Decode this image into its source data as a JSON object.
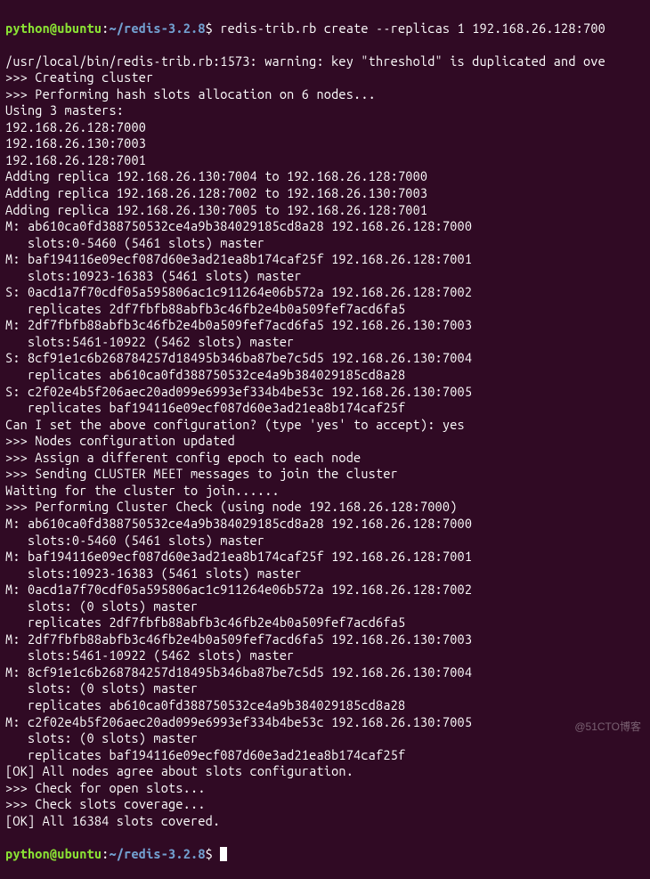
{
  "prompt": {
    "user": "python",
    "host": "ubuntu",
    "path": "~/redis-3.2.8",
    "symbol": "$"
  },
  "command": "redis-trib.rb create --replicas 1 192.168.26.128:700",
  "lines": [
    "/usr/local/bin/redis-trib.rb:1573: warning: key \"threshold\" is duplicated and ove",
    ">>> Creating cluster",
    ">>> Performing hash slots allocation on 6 nodes...",
    "Using 3 masters:",
    "192.168.26.128:7000",
    "192.168.26.130:7003",
    "192.168.26.128:7001",
    "Adding replica 192.168.26.130:7004 to 192.168.26.128:7000",
    "Adding replica 192.168.26.128:7002 to 192.168.26.130:7003",
    "Adding replica 192.168.26.130:7005 to 192.168.26.128:7001",
    "M: ab610ca0fd388750532ce4a9b384029185cd8a28 192.168.26.128:7000",
    "   slots:0-5460 (5461 slots) master",
    "M: baf194116e09ecf087d60e3ad21ea8b174caf25f 192.168.26.128:7001",
    "   slots:10923-16383 (5461 slots) master",
    "S: 0acd1a7f70cdf05a595806ac1c911264e06b572a 192.168.26.128:7002",
    "   replicates 2df7fbfb88abfb3c46fb2e4b0a509fef7acd6fa5",
    "M: 2df7fbfb88abfb3c46fb2e4b0a509fef7acd6fa5 192.168.26.130:7003",
    "   slots:5461-10922 (5462 slots) master",
    "S: 8cf91e1c6b268784257d18495b346ba87be7c5d5 192.168.26.130:7004",
    "   replicates ab610ca0fd388750532ce4a9b384029185cd8a28",
    "S: c2f02e4b5f206aec20ad099e6993ef334b4be53c 192.168.26.130:7005",
    "   replicates baf194116e09ecf087d60e3ad21ea8b174caf25f",
    "Can I set the above configuration? (type 'yes' to accept): yes",
    ">>> Nodes configuration updated",
    ">>> Assign a different config epoch to each node",
    ">>> Sending CLUSTER MEET messages to join the cluster",
    "Waiting for the cluster to join......",
    ">>> Performing Cluster Check (using node 192.168.26.128:7000)",
    "M: ab610ca0fd388750532ce4a9b384029185cd8a28 192.168.26.128:7000",
    "   slots:0-5460 (5461 slots) master",
    "M: baf194116e09ecf087d60e3ad21ea8b174caf25f 192.168.26.128:7001",
    "   slots:10923-16383 (5461 slots) master",
    "M: 0acd1a7f70cdf05a595806ac1c911264e06b572a 192.168.26.128:7002",
    "   slots: (0 slots) master",
    "   replicates 2df7fbfb88abfb3c46fb2e4b0a509fef7acd6fa5",
    "M: 2df7fbfb88abfb3c46fb2e4b0a509fef7acd6fa5 192.168.26.130:7003",
    "   slots:5461-10922 (5462 slots) master",
    "M: 8cf91e1c6b268784257d18495b346ba87be7c5d5 192.168.26.130:7004",
    "   slots: (0 slots) master",
    "   replicates ab610ca0fd388750532ce4a9b384029185cd8a28",
    "M: c2f02e4b5f206aec20ad099e6993ef334b4be53c 192.168.26.130:7005",
    "   slots: (0 slots) master",
    "   replicates baf194116e09ecf087d60e3ad21ea8b174caf25f",
    "[OK] All nodes agree about slots configuration.",
    ">>> Check for open slots...",
    ">>> Check slots coverage...",
    "[OK] All 16384 slots covered."
  ],
  "watermark": "@51CTO博客"
}
